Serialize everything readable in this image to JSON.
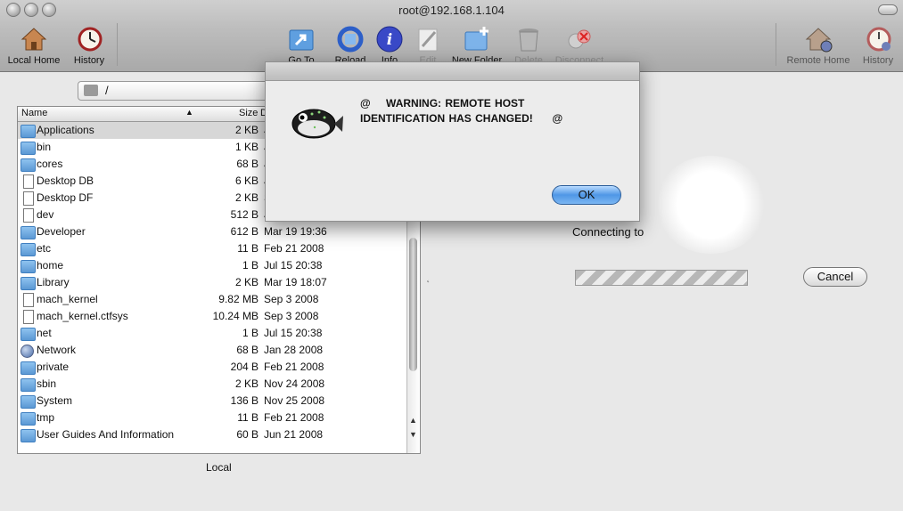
{
  "window": {
    "title": "root@192.168.1.104"
  },
  "toolbar": {
    "left": [
      {
        "label": "Local Home",
        "icon": "house-icon"
      },
      {
        "label": "History",
        "icon": "clock-icon"
      }
    ],
    "center": [
      {
        "label": "Go To",
        "icon": "goto-folder-icon",
        "enabled": true
      },
      {
        "label": "Reload",
        "icon": "reload-icon",
        "enabled": true
      },
      {
        "label": "Info",
        "icon": "info-icon",
        "enabled": true
      },
      {
        "label": "Edit",
        "icon": "edit-icon",
        "enabled": false
      },
      {
        "label": "New Folder",
        "icon": "new-folder-icon",
        "enabled": true
      },
      {
        "label": "Delete",
        "icon": "trash-icon",
        "enabled": false
      },
      {
        "label": "Disconnect",
        "icon": "disconnect-icon",
        "enabled": false
      }
    ],
    "right": [
      {
        "label": "Remote Home",
        "icon": "remote-house-icon"
      },
      {
        "label": "History",
        "icon": "clock-icon"
      }
    ]
  },
  "local_pane": {
    "path": "/",
    "columns": {
      "name": "Name",
      "size": "Size",
      "date": "D"
    },
    "footer": "Local",
    "files": [
      {
        "name": "Applications",
        "size": "2 KB",
        "date": "J",
        "type": "app-folder"
      },
      {
        "name": "bin",
        "size": "1 KB",
        "date": "J",
        "type": "folder"
      },
      {
        "name": "cores",
        "size": "68 B",
        "date": "J",
        "type": "folder"
      },
      {
        "name": "Desktop DB",
        "size": "6 KB",
        "date": "J",
        "type": "doc"
      },
      {
        "name": "Desktop DF",
        "size": "2 KB",
        "date": "S",
        "type": "doc"
      },
      {
        "name": "dev",
        "size": "512 B",
        "date": "J",
        "type": "doc"
      },
      {
        "name": "Developer",
        "size": "612 B",
        "date": "Mar 19 19:36",
        "type": "app-folder"
      },
      {
        "name": "etc",
        "size": "11 B",
        "date": "Feb 21 2008",
        "type": "folder"
      },
      {
        "name": "home",
        "size": "1 B",
        "date": "Jul 15 20:38",
        "type": "net-folder"
      },
      {
        "name": "Library",
        "size": "2 KB",
        "date": "Mar 19 18:07",
        "type": "app-folder"
      },
      {
        "name": "mach_kernel",
        "size": "9.82 MB",
        "date": "Sep 3 2008",
        "type": "doc"
      },
      {
        "name": "mach_kernel.ctfsys",
        "size": "10.24 MB",
        "date": "Sep 3 2008",
        "type": "doc"
      },
      {
        "name": "net",
        "size": "1 B",
        "date": "Jul 15 20:38",
        "type": "net-folder"
      },
      {
        "name": "Network",
        "size": "68 B",
        "date": "Jan 28 2008",
        "type": "globe"
      },
      {
        "name": "private",
        "size": "204 B",
        "date": "Feb 21 2008",
        "type": "folder"
      },
      {
        "name": "sbin",
        "size": "2 KB",
        "date": "Nov 24 2008",
        "type": "folder"
      },
      {
        "name": "System",
        "size": "136 B",
        "date": "Nov 25 2008",
        "type": "app-folder"
      },
      {
        "name": "tmp",
        "size": "11 B",
        "date": "Feb 21 2008",
        "type": "folder"
      },
      {
        "name": "User Guides And Information",
        "size": "60 B",
        "date": "Jun 21 2008",
        "type": "folder"
      }
    ]
  },
  "remote_pane": {
    "connecting_label": "Connecting to",
    "cancel_label": "Cancel"
  },
  "dialog": {
    "line1": "@    WARNING: REMOTE HOST",
    "line2": "IDENTIFICATION HAS CHANGED!     @",
    "ok_label": "OK"
  }
}
